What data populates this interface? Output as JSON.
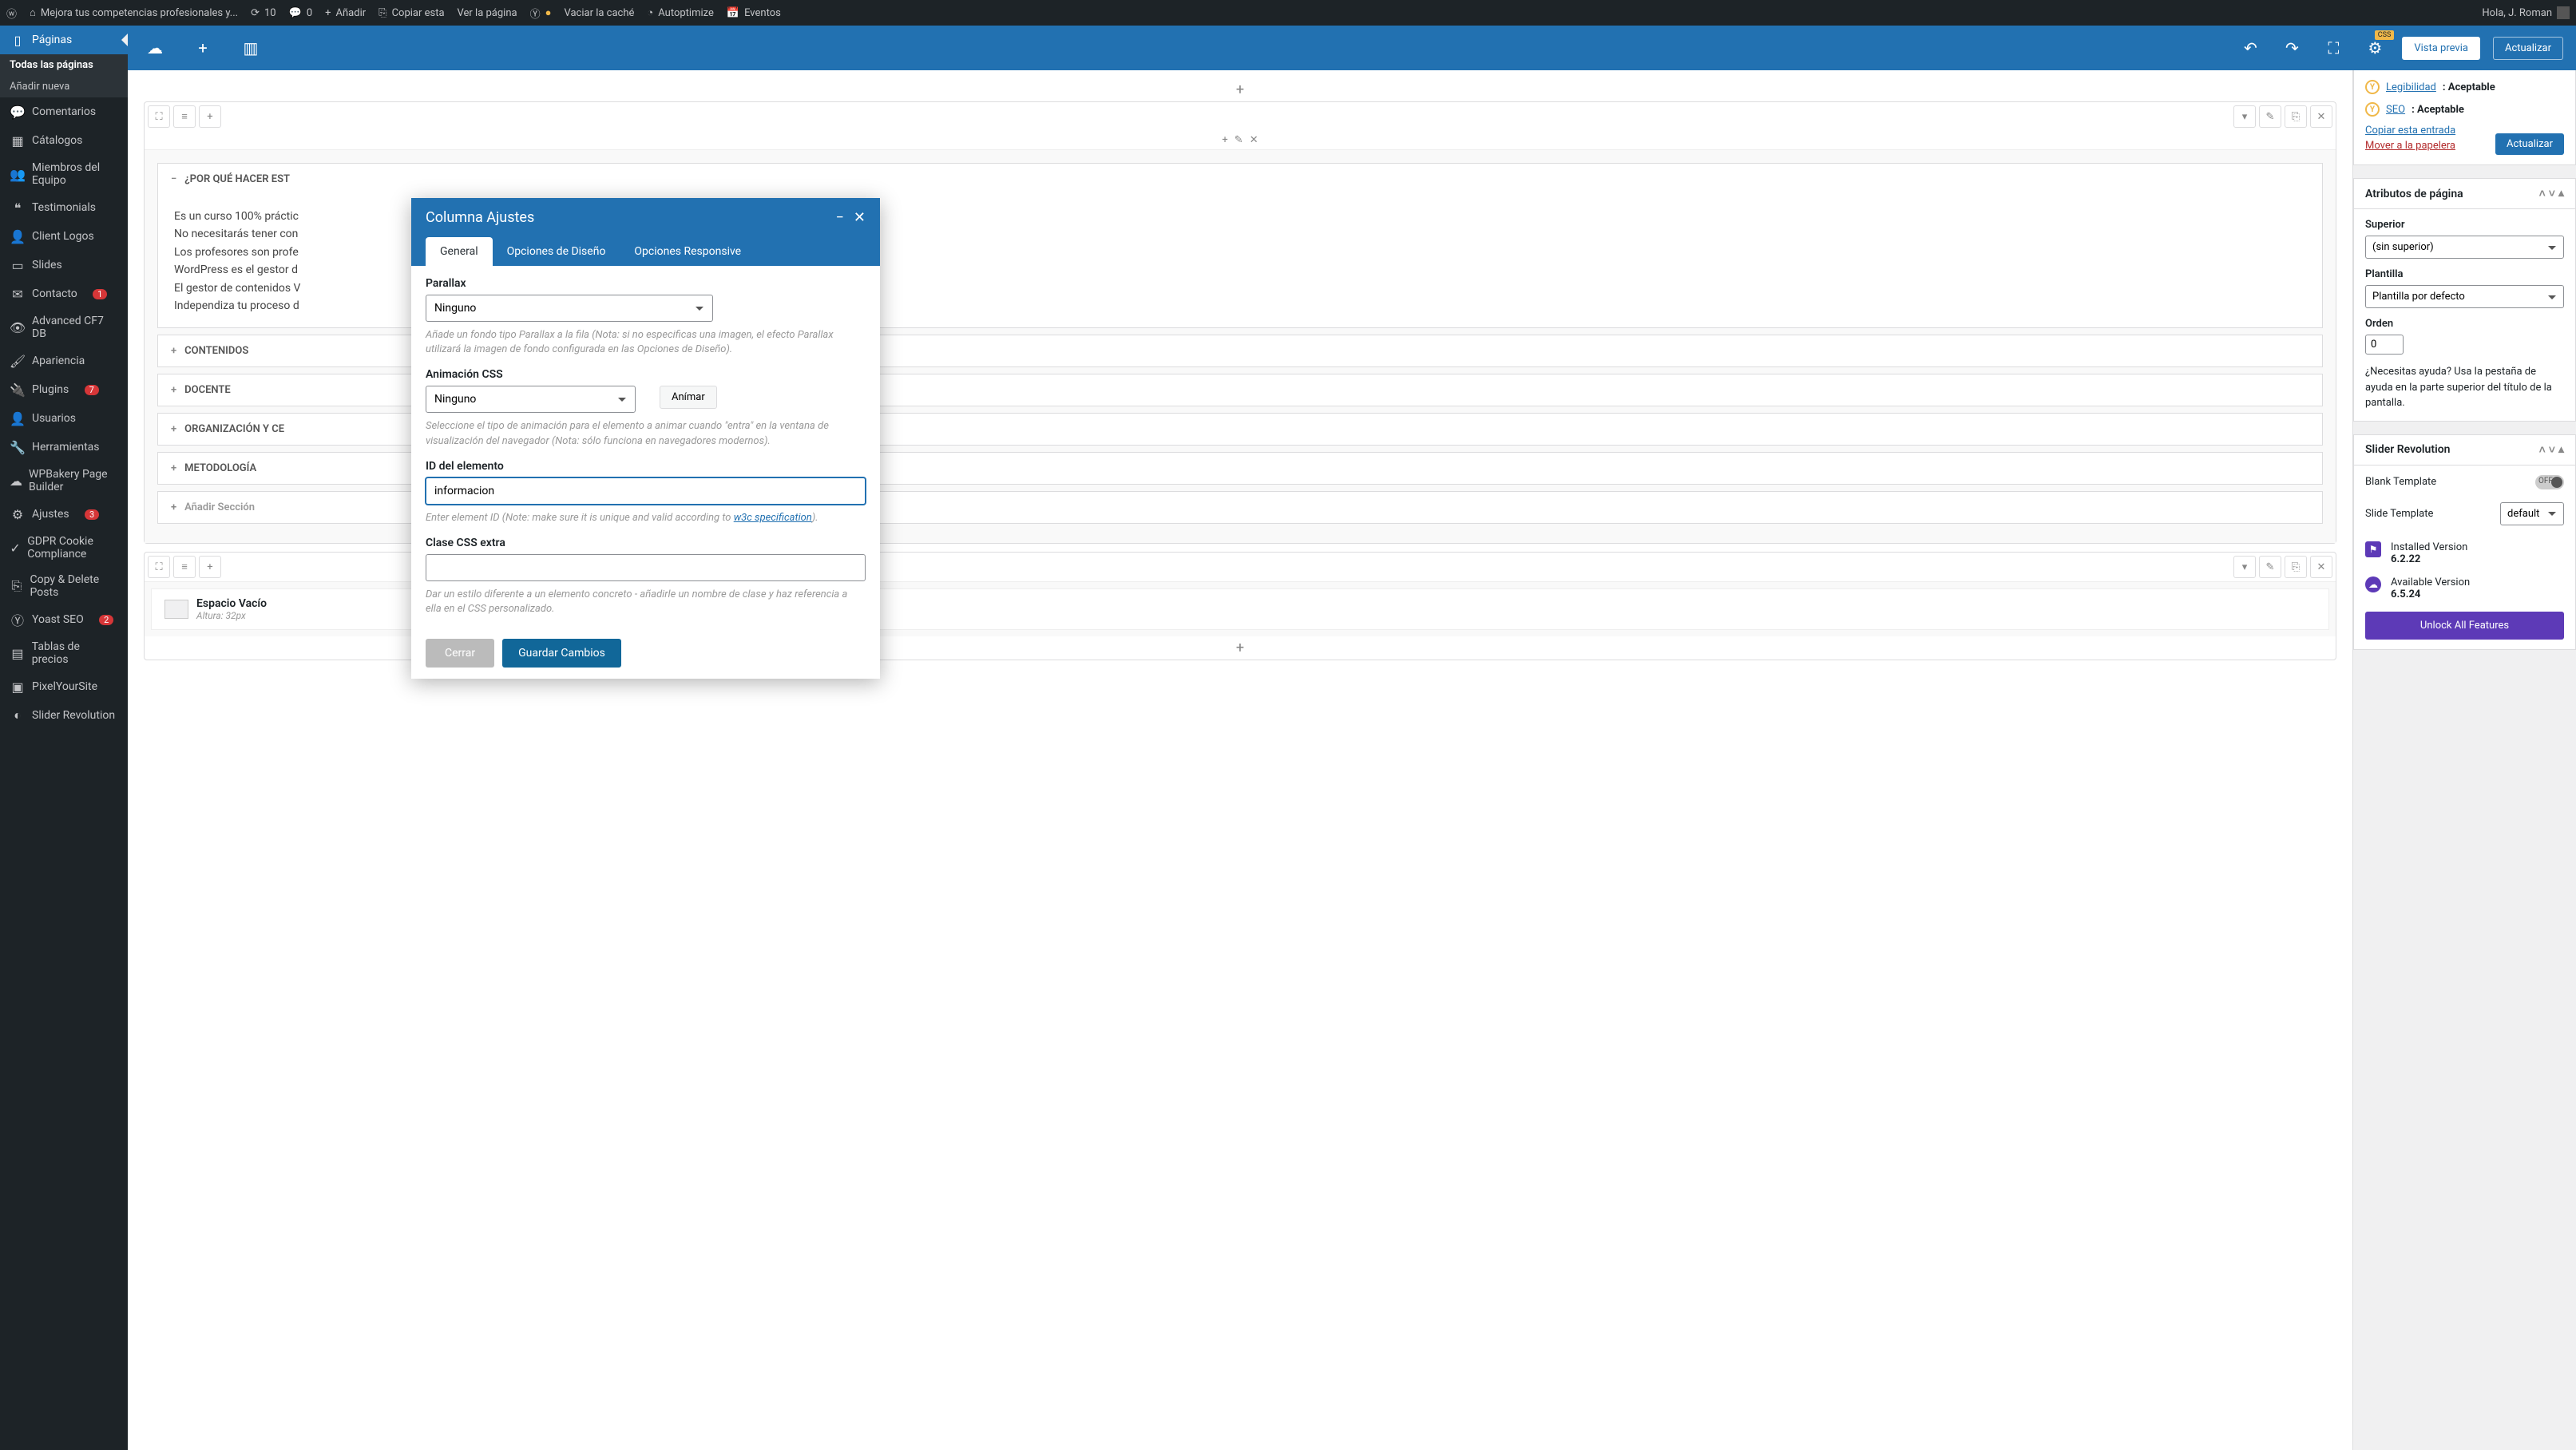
{
  "adminBar": {
    "siteName": "Mejora tus competencias profesionales y...",
    "updates": "10",
    "comments": "0",
    "addNew": "Añadir",
    "copyThis": "Copiar esta",
    "viewPage": "Ver la página",
    "clearCache": "Vaciar la caché",
    "autoptimize": "Autoptimize",
    "events": "Eventos",
    "greeting": "Hola, J. Roman"
  },
  "sidebar": {
    "pages": "Páginas",
    "allPages": "Todas las páginas",
    "addNew": "Añadir nueva",
    "comments": "Comentarios",
    "catalogs": "Cátalogos",
    "team": "Miembros del Equipo",
    "testimonials": "Testimonials",
    "clientLogos": "Client Logos",
    "slides": "Slides",
    "contact": "Contacto",
    "contactBadge": "1",
    "cf7": "Advanced CF7 DB",
    "appearance": "Apariencia",
    "plugins": "Plugins",
    "pluginsBadge": "7",
    "users": "Usuarios",
    "tools": "Herramientas",
    "wpbakery": "WPBakery Page Builder",
    "settings": "Ajustes",
    "settingsBadge": "3",
    "gdpr": "GDPR Cookie Compliance",
    "copyDelete": "Copy & Delete Posts",
    "yoast": "Yoast SEO",
    "yoastBadge": "2",
    "priceTables": "Tablas de precios",
    "pixelYourSite": "PixelYourSite",
    "sliderRev": "Slider Revolution"
  },
  "editorToolbar": {
    "preview": "Vista previa",
    "update": "Actualizar",
    "cssBadge": "CSS"
  },
  "accordion": {
    "why": "¿POR QUÉ HACER EST",
    "content1": "Es un curso 100% práctic",
    "content2": "No necesitarás tener con",
    "content3": "Los profesores son profe",
    "content4": "WordPress es el gestor d",
    "content5": "El gestor de contenidos V",
    "content6": "Independiza tu proceso d",
    "contents": "CONTENIDOS",
    "teacher": "DOCENTE",
    "org": "ORGANIZACIÓN Y CE",
    "method": "METODOLOGÍA",
    "addSection": "Añadir Sección"
  },
  "emptyWidget": {
    "title": "Espacio Vacío",
    "sub": "Altura: 32px"
  },
  "modal": {
    "title": "Columna Ajustes",
    "tabGeneral": "General",
    "tabDesign": "Opciones de Diseño",
    "tabResponsive": "Opciones Responsive",
    "parallaxLabel": "Parallax",
    "parallaxValue": "Ninguno",
    "parallaxHelp": "Añade un fondo tipo Parallax a la fila (Nota: si no especificas una imagen, el efecto Parallax utilizará la imagen de fondo configurada en las Opciones de Diseño).",
    "animLabel": "Animación CSS",
    "animValue": "Ninguno",
    "animBtn": "Anímar",
    "animHelp": "Seleccione el tipo de animación para el elemento a animar cuando \"entra\" en la ventana de visualización del navegador (Nota: sólo funciona en navegadores modernos).",
    "idLabel": "ID del elemento",
    "idValue": "informacion",
    "idHelp1": "Enter element ID (Note: make sure it is unique and valid according to ",
    "idHelpLink": "w3c specification",
    "idHelp2": ").",
    "cssLabel": "Clase CSS extra",
    "cssHelp": "Dar un estilo diferente a un elemento concreto - añadirle un nombre de clase y haz referencia a ella en el CSS personalizado.",
    "cancel": "Cerrar",
    "save": "Guardar Cambios"
  },
  "rightPanel": {
    "readability": "Legibilidad",
    "readabilityVal": ": Aceptable",
    "seo": "SEO",
    "seoVal": ": Aceptable",
    "copyEntry": "Copiar esta entrada",
    "moveToTrash": "Mover a la papelera",
    "updateBtn": "Actualizar",
    "attrTitle": "Atributos de página",
    "superiorLabel": "Superior",
    "superiorValue": "(sin superior)",
    "templateLabel": "Plantilla",
    "templateValue": "Plantilla por defecto",
    "orderLabel": "Orden",
    "orderValue": "0",
    "helpText": "¿Necesitas ayuda? Usa la pestaña de ayuda en la parte superior del título de la pantalla.",
    "sliderTitle": "Slider Revolution",
    "blankTemplate": "Blank Template",
    "slideTemplate": "Slide Template",
    "slideTemplateValue": "default",
    "installedLabel": "Installed Version",
    "installedValue": "6.2.22",
    "availableLabel": "Available Version",
    "availableValue": "6.5.24",
    "unlockBtn": "Unlock All Features"
  }
}
